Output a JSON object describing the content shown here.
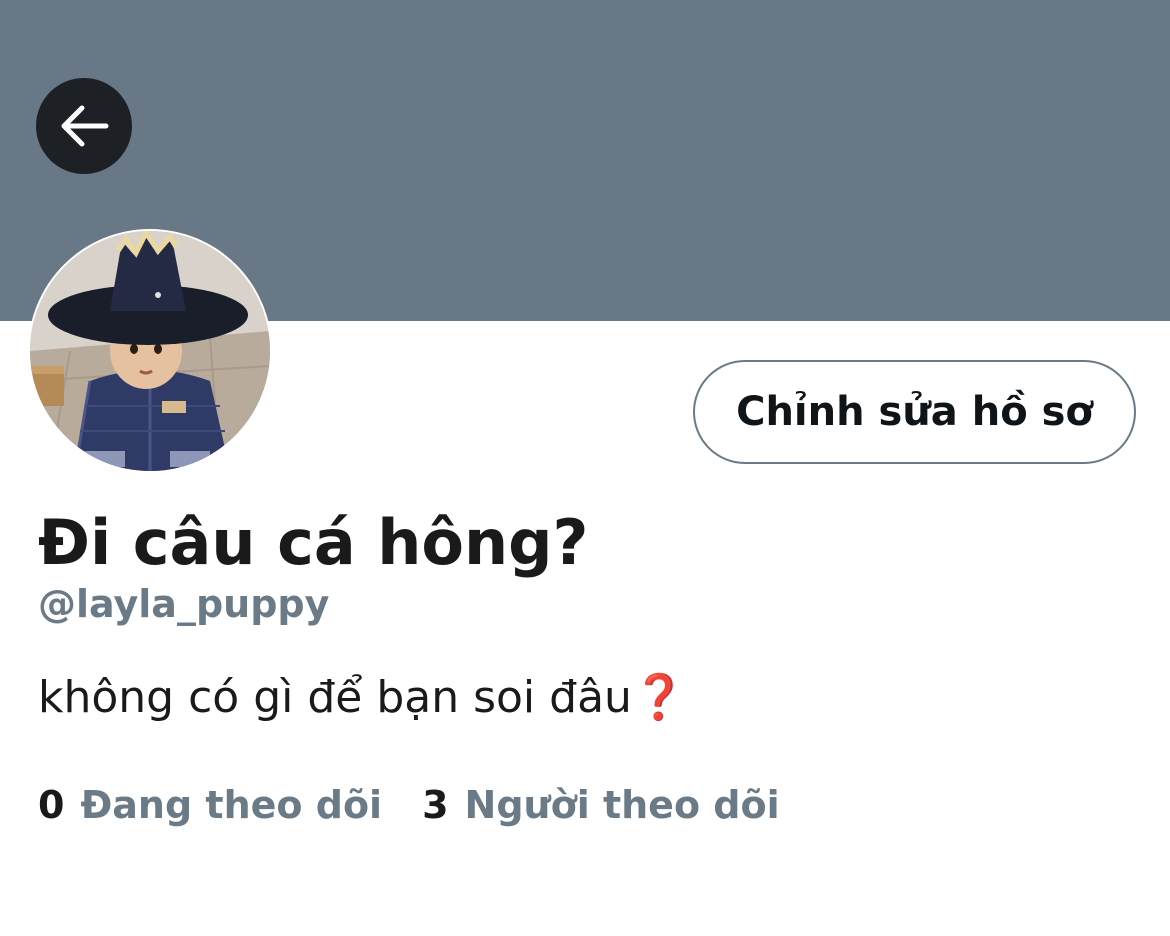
{
  "colors": {
    "banner": "#697886",
    "back_button_bg": "#1d2024",
    "muted_text": "#6b7a87",
    "primary_text": "#1a1a1a",
    "emoji_red": "#d23a2b"
  },
  "header": {
    "back_icon": "arrow-left-icon"
  },
  "profile": {
    "edit_button_label": "Chỉnh sửa hồ sơ",
    "display_name": "Đi câu cá hông?",
    "handle": "@layla_puppy",
    "bio_text": "không có gì để bạn soi đâu",
    "bio_emoji": "❓",
    "stats": {
      "following_count": "0",
      "following_label": "Đang theo dõi",
      "followers_count": "3",
      "followers_label": "Người theo dõi"
    }
  }
}
